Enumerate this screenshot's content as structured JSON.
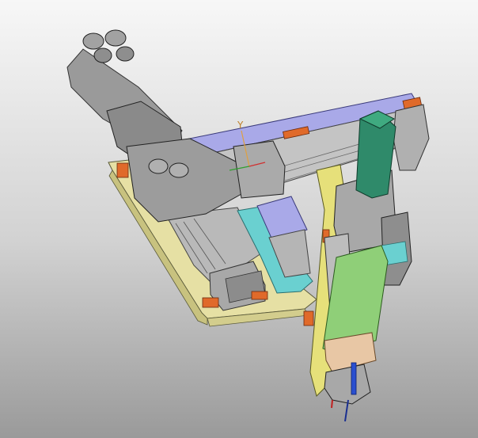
{
  "viewport": {
    "triad_label": "Y",
    "background_top": "#f7f7f7",
    "background_bottom": "#9a9a9a"
  },
  "colors": {
    "base_plate": "#e6e0a4",
    "rail_purple": "#a9a9e8",
    "motor_gray": "#9a9a9a",
    "cylinder_green": "#2f8a6a",
    "z_plate_green": "#8fcf78",
    "bracket_yellow": "#e6e07a",
    "accent_orange": "#e06a2a",
    "teal_slider": "#6ad0d0",
    "beige_block": "#e8c7a5",
    "probe_blue": "#2a4fd0"
  }
}
